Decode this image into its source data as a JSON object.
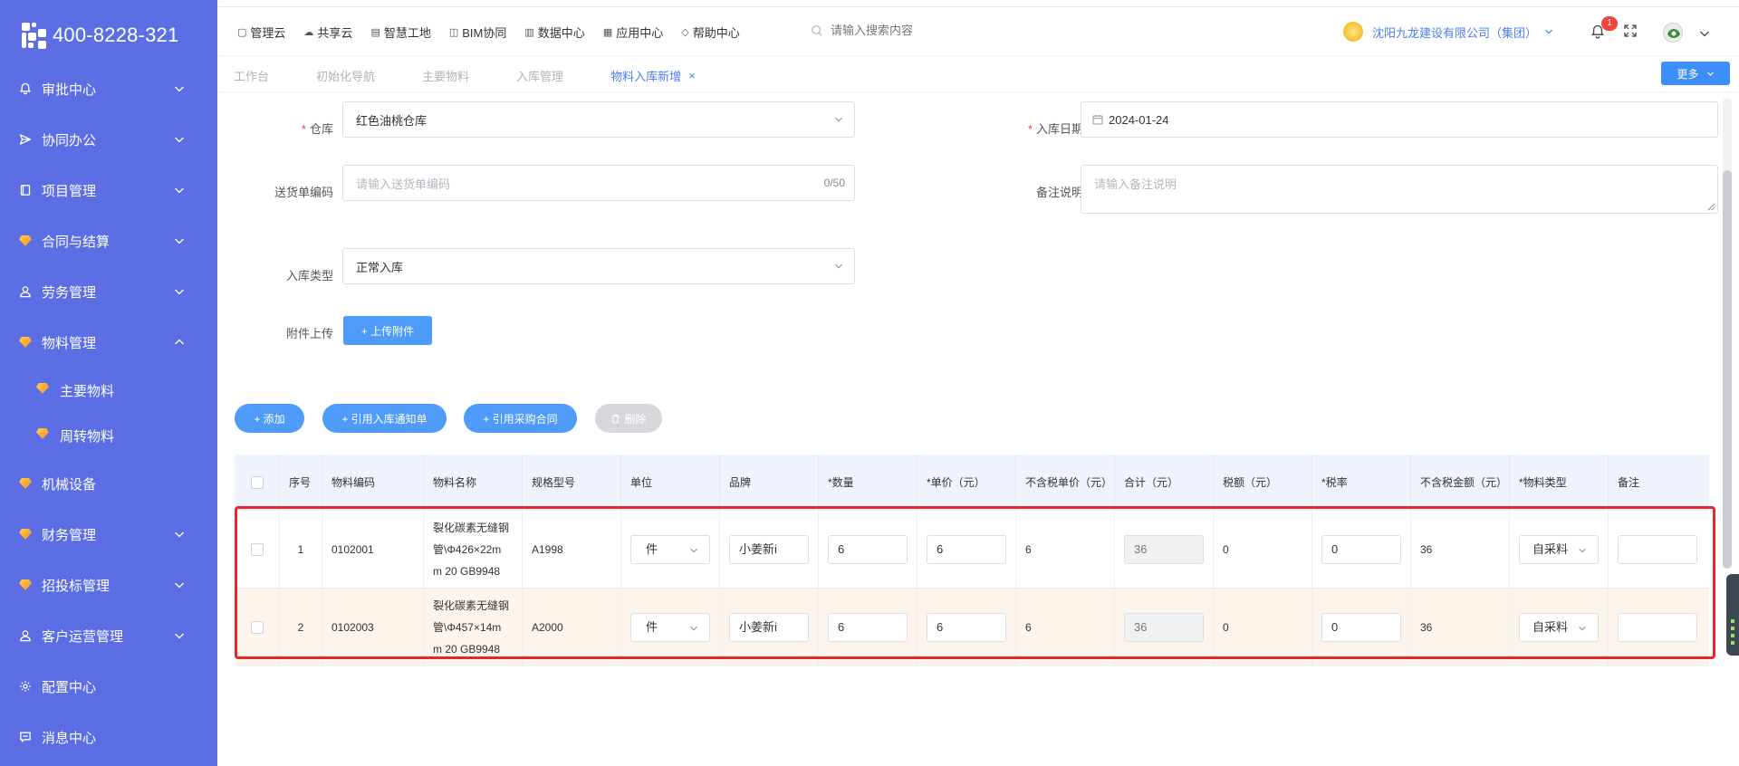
{
  "sidebar": {
    "phone": "400-8228-321",
    "items": [
      {
        "label": "审批中心",
        "icon": "bell-icon",
        "chevron": "down"
      },
      {
        "label": "协同办公",
        "icon": "send-icon",
        "chevron": "down"
      },
      {
        "label": "项目管理",
        "icon": "book-icon",
        "chevron": "down"
      },
      {
        "label": "合同与结算",
        "icon": "gem-icon",
        "chevron": "down"
      },
      {
        "label": "劳务管理",
        "icon": "user-icon",
        "chevron": "down"
      },
      {
        "label": "物料管理",
        "icon": "gem-icon",
        "chevron": "up"
      },
      {
        "label": "主要物料",
        "icon": "gem-icon",
        "sub": true
      },
      {
        "label": "周转物料",
        "icon": "gem-icon",
        "sub": true
      },
      {
        "label": "机械设备",
        "icon": "gem-icon",
        "chevron": ""
      },
      {
        "label": "财务管理",
        "icon": "gem-icon",
        "chevron": "down"
      },
      {
        "label": "招投标管理",
        "icon": "gem-icon",
        "chevron": "down"
      },
      {
        "label": "客户运营管理",
        "icon": "user-icon",
        "chevron": "down"
      },
      {
        "label": "配置中心",
        "icon": "gear-icon",
        "chevron": ""
      },
      {
        "label": "消息中心",
        "icon": "message-icon",
        "chevron": ""
      }
    ]
  },
  "header": {
    "topnav": [
      "管理云",
      "共享云",
      "智慧工地",
      "BIM协同",
      "数据中心",
      "应用中心",
      "帮助中心"
    ],
    "search_placeholder": "请输入搜索内容",
    "company": "沈阳九龙建设有限公司（集团）",
    "notification_count": "1"
  },
  "tabs": {
    "items": [
      "工作台",
      "初始化导航",
      "主要物料",
      "入库管理"
    ],
    "active": "物料入库新增",
    "close": "×",
    "more": "更多"
  },
  "form": {
    "warehouse_label": "仓库",
    "warehouse_value": "红色油桃仓库",
    "date_label": "入库日期",
    "date_value": "2024-01-24",
    "delivery_label": "送货单编码",
    "delivery_placeholder": "请输入送货单编码",
    "delivery_counter": "0/50",
    "remark_label": "备注说明",
    "remark_placeholder": "请输入备注说明",
    "type_label": "入库类型",
    "type_value": "正常入库",
    "attach_label": "附件上传",
    "upload_button": "+ 上传附件"
  },
  "toolbar": {
    "add": "+ 添加",
    "ref_notice": "+ 引用入库通知单",
    "ref_contract": "+ 引用采购合同",
    "delete": "删除"
  },
  "table": {
    "headers": [
      "序号",
      "物料编码",
      "物料名称",
      "规格型号",
      "单位",
      "品牌",
      "*数量",
      "*单价（元）",
      "不含税单价（元）",
      "合计（元）",
      "税额（元）",
      "*税率",
      "不含税金额（元）",
      "*物料类型",
      "备注"
    ],
    "rows": [
      {
        "index": "1",
        "code": "0102001",
        "name_l1": "裂化碳素无缝钢",
        "name_l2": "管\\Φ426×22m",
        "name_l3": "m 20 GB9948",
        "spec": "A1998",
        "unit": "件",
        "brand": "小姜新i",
        "qty": "6",
        "price": "6",
        "price_ex": "6",
        "total": "36",
        "tax": "0",
        "rate": "0",
        "amount_ex": "36",
        "mtype": "自采料",
        "note": ""
      },
      {
        "index": "2",
        "code": "0102003",
        "name_l1": "裂化碳素无缝钢",
        "name_l2": "管\\Φ457×14m",
        "name_l3": "m 20 GB9948",
        "spec": "A2000",
        "unit": "件",
        "brand": "小姜新i",
        "qty": "6",
        "price": "6",
        "price_ex": "6",
        "total": "36",
        "tax": "0",
        "rate": "0",
        "amount_ex": "36",
        "mtype": "自采料",
        "note": ""
      }
    ]
  },
  "colors": {
    "sidebar": "#5b6ee4",
    "primary": "#4f9bfa",
    "highlight": "#e8272b",
    "row_alt": "#fdf5eb",
    "header_bg": "#eef3fd"
  }
}
